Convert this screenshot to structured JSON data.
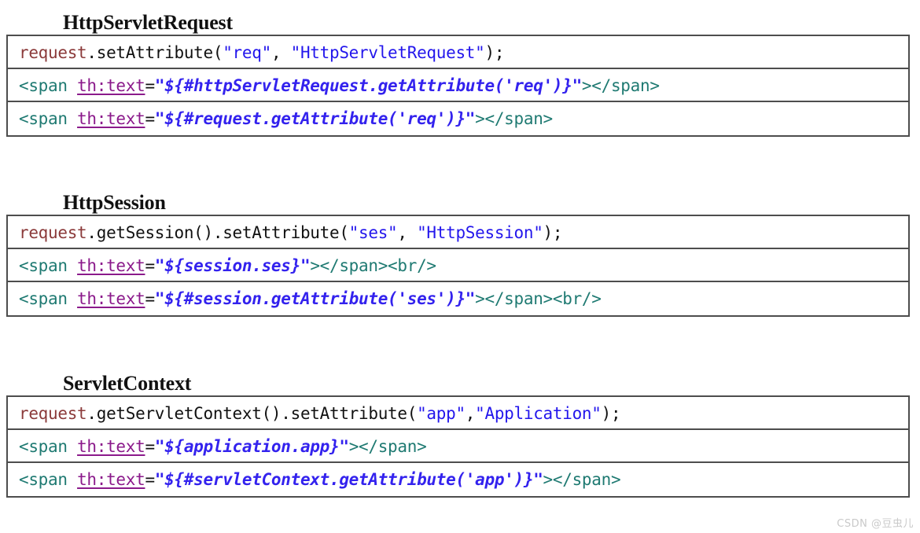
{
  "watermark": "CSDN @豆虫儿",
  "colors": {
    "object": "#8b3a3a",
    "plain": "#111111",
    "string_literal": "#2316ec",
    "tag": "#1f7a72",
    "attribute": "#8b1a8b",
    "attribute_value": "#3322ee",
    "border": "#4d4d4d",
    "background": "#ffffff"
  },
  "sections": [
    {
      "heading": "HttpServletRequest",
      "rows": [
        {
          "kind": "java",
          "full_text": "request.setAttribute(\"req\", \"HttpServletRequest\");",
          "tokens": [
            {
              "cls": "t-obj",
              "text": "request"
            },
            {
              "cls": "t-plain",
              "text": ".setAttribute("
            },
            {
              "cls": "t-string",
              "text": "\"req\""
            },
            {
              "cls": "t-plain",
              "text": ", "
            },
            {
              "cls": "t-string",
              "text": "\"HttpServletRequest\""
            },
            {
              "cls": "t-plain",
              "text": ");"
            }
          ]
        },
        {
          "kind": "html",
          "full_text": "<span th:text=\"${#httpServletRequest.getAttribute('req')}\"></span>",
          "tokens": [
            {
              "cls": "t-tag",
              "text": "<span "
            },
            {
              "cls": "t-attr",
              "text": "th:text"
            },
            {
              "cls": "t-eq",
              "text": "="
            },
            {
              "cls": "t-val",
              "text": "\"${#httpServletRequest.getAttribute('req')}\""
            },
            {
              "cls": "t-tag",
              "text": "></span>"
            }
          ]
        },
        {
          "kind": "html",
          "full_text": "<span th:text=\"${#request.getAttribute('req')}\"></span>",
          "tokens": [
            {
              "cls": "t-tag",
              "text": "<span "
            },
            {
              "cls": "t-attr",
              "text": "th:text"
            },
            {
              "cls": "t-eq",
              "text": "="
            },
            {
              "cls": "t-val",
              "text": "\"${#request.getAttribute('req')}\""
            },
            {
              "cls": "t-tag",
              "text": "></span>"
            }
          ]
        }
      ]
    },
    {
      "heading": "HttpSession",
      "rows": [
        {
          "kind": "java",
          "full_text": "request.getSession().setAttribute(\"ses\", \"HttpSession\");",
          "tokens": [
            {
              "cls": "t-obj",
              "text": "request"
            },
            {
              "cls": "t-plain",
              "text": ".getSession().setAttribute("
            },
            {
              "cls": "t-string",
              "text": "\"ses\""
            },
            {
              "cls": "t-plain",
              "text": ", "
            },
            {
              "cls": "t-string",
              "text": "\"HttpSession\""
            },
            {
              "cls": "t-plain",
              "text": ");"
            }
          ]
        },
        {
          "kind": "html",
          "full_text": "<span th:text=\"${session.ses}\"></span><br/>",
          "tokens": [
            {
              "cls": "t-tag",
              "text": "<span "
            },
            {
              "cls": "t-attr",
              "text": "th:text"
            },
            {
              "cls": "t-eq",
              "text": "="
            },
            {
              "cls": "t-val",
              "text": "\"${session.ses}\""
            },
            {
              "cls": "t-tag",
              "text": "></span><br/>"
            }
          ]
        },
        {
          "kind": "html",
          "full_text": "<span th:text=\"${#session.getAttribute('ses')}\"></span><br/>",
          "tokens": [
            {
              "cls": "t-tag",
              "text": "<span "
            },
            {
              "cls": "t-attr",
              "text": "th:text"
            },
            {
              "cls": "t-eq",
              "text": "="
            },
            {
              "cls": "t-val",
              "text": "\"${#session.getAttribute('ses')}\""
            },
            {
              "cls": "t-tag",
              "text": "></span><br/>"
            }
          ]
        }
      ]
    },
    {
      "heading": "ServletContext",
      "rows": [
        {
          "kind": "java",
          "full_text": "request.getServletContext().setAttribute(\"app\",\"Application\");",
          "tokens": [
            {
              "cls": "t-obj",
              "text": "request"
            },
            {
              "cls": "t-plain",
              "text": ".getServletContext().setAttribute("
            },
            {
              "cls": "t-string",
              "text": "\"app\""
            },
            {
              "cls": "t-plain",
              "text": ","
            },
            {
              "cls": "t-string",
              "text": "\"Application\""
            },
            {
              "cls": "t-plain",
              "text": ");"
            }
          ]
        },
        {
          "kind": "html",
          "full_text": "<span th:text=\"${application.app}\"></span>",
          "tokens": [
            {
              "cls": "t-tag",
              "text": "<span "
            },
            {
              "cls": "t-attr",
              "text": "th:text"
            },
            {
              "cls": "t-eq",
              "text": "="
            },
            {
              "cls": "t-val",
              "text": "\"${application.app}\""
            },
            {
              "cls": "t-tag",
              "text": "></span>"
            }
          ]
        },
        {
          "kind": "html",
          "full_text": "<span th:text=\"${#servletContext.getAttribute('app')}\"></span>",
          "tokens": [
            {
              "cls": "t-tag",
              "text": "<span "
            },
            {
              "cls": "t-attr",
              "text": "th:text"
            },
            {
              "cls": "t-eq",
              "text": "="
            },
            {
              "cls": "t-val",
              "text": "\"${#servletContext.getAttribute('app')}\""
            },
            {
              "cls": "t-tag",
              "text": "></span>"
            }
          ]
        }
      ]
    }
  ],
  "layout": {
    "section_tops": [
      14,
      243,
      473
    ]
  }
}
